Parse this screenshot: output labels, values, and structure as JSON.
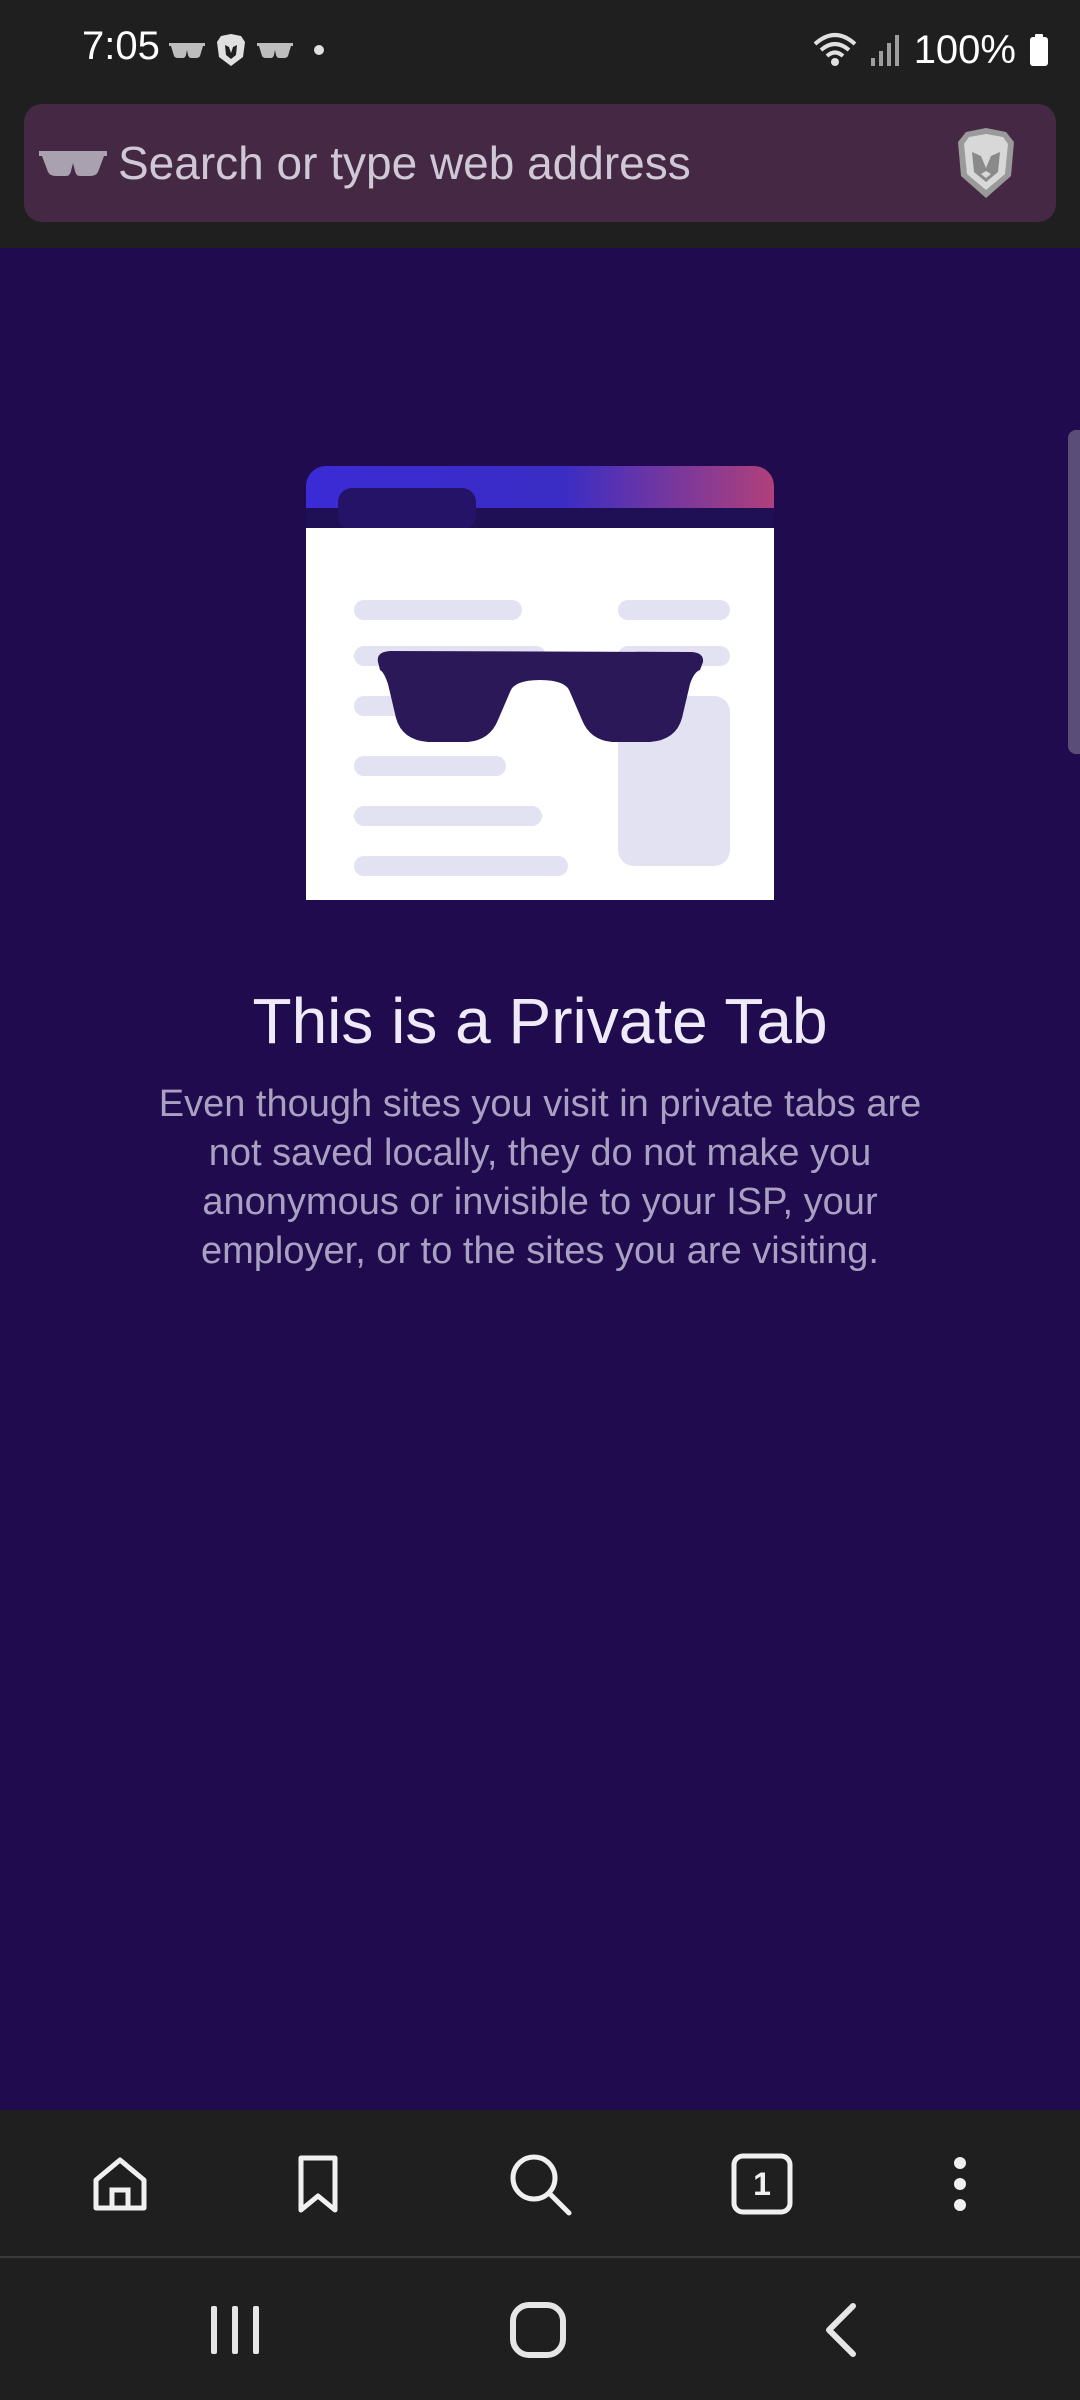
{
  "status_bar": {
    "time": "7:05",
    "battery": "100%",
    "notification_icons": [
      "private-glasses-icon",
      "brave-lion-icon",
      "private-glasses-icon",
      "dot-icon"
    ],
    "system_icons": [
      "wifi-icon",
      "signal-icon",
      "battery-icon"
    ]
  },
  "toolbar": {
    "search_placeholder": "Search or type web address",
    "private_icon": "private-glasses-icon",
    "shields_icon": "brave-lion-icon"
  },
  "main": {
    "title": "This is a Private Tab",
    "description": "Even though sites you visit in private tabs are not saved locally, they do not make you anonymous or invisible to your ISP, your employer, or to the sites you are visiting."
  },
  "bottom_nav": {
    "items": [
      {
        "name": "home",
        "icon": "home-icon"
      },
      {
        "name": "bookmarks",
        "icon": "bookmark-icon"
      },
      {
        "name": "search",
        "icon": "search-icon"
      },
      {
        "name": "tabs",
        "icon": "tab-switcher-icon",
        "count": "1"
      },
      {
        "name": "menu",
        "icon": "more-vertical-icon"
      }
    ]
  },
  "system_nav": {
    "items": [
      "recent-apps-icon",
      "home-circle-icon",
      "back-icon"
    ]
  },
  "colors": {
    "background": "#1f0b4e",
    "toolbar": "#1f1f1f",
    "urlbar": "#452843",
    "accent_gradient_start": "#3b2bd6",
    "accent_gradient_end": "#b0407a"
  }
}
